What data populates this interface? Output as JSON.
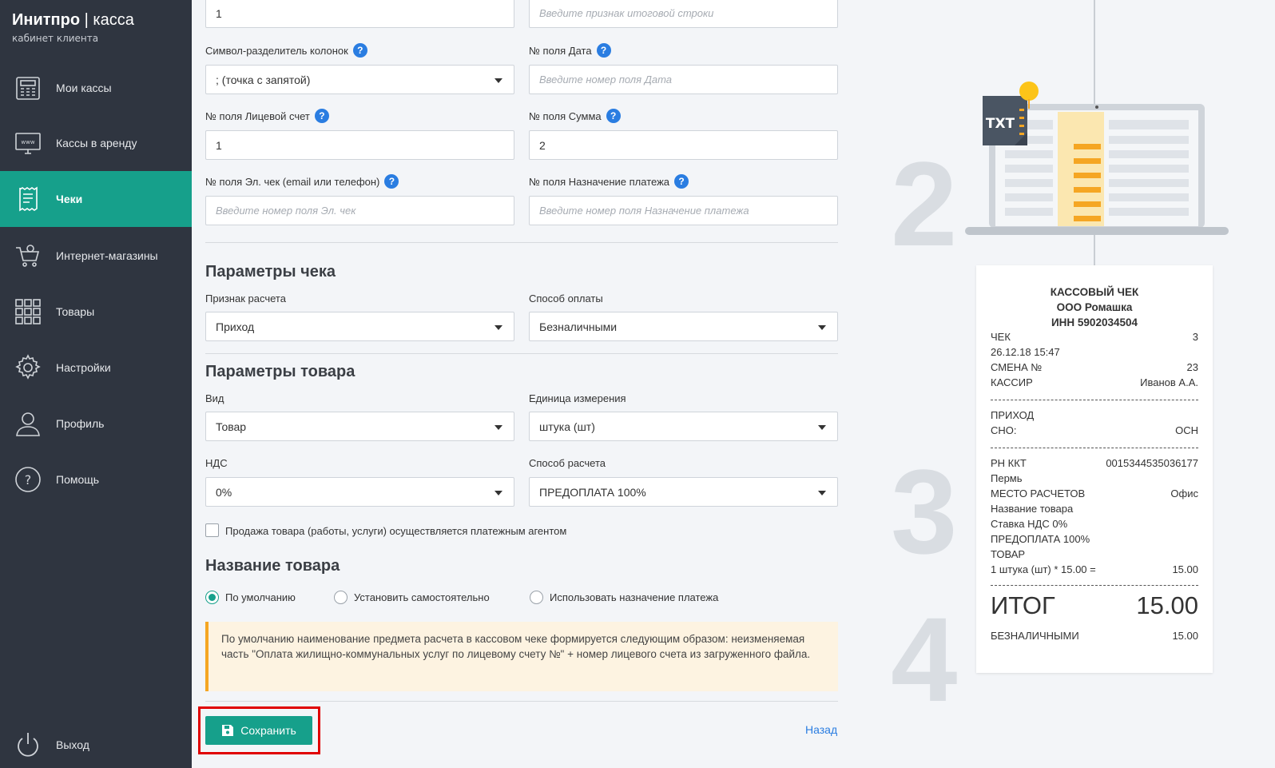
{
  "brand": {
    "name": "Инитпро",
    "sep": " | ",
    "product": "касса",
    "subtitle": "кабинет клиента"
  },
  "sidebar": {
    "items": [
      {
        "label": "Мои кассы"
      },
      {
        "label": "Кассы в аренду"
      },
      {
        "label": "Чеки"
      },
      {
        "label": "Интернет-магазины"
      },
      {
        "label": "Товары"
      },
      {
        "label": "Настройки"
      },
      {
        "label": "Профиль"
      },
      {
        "label": "Помощь"
      }
    ],
    "active_index": 2,
    "logout": "Выход"
  },
  "form": {
    "top_left_value": "1",
    "top_right_placeholder": "Введите признак итоговой строки",
    "col_sep": {
      "label": "Символ-разделитель колонок",
      "value": "; (точка с запятой)"
    },
    "date_field": {
      "label": "№ поля Дата",
      "placeholder": "Введите номер поля Дата"
    },
    "account_field": {
      "label": "№ поля Лицевой счет",
      "value": "1"
    },
    "sum_field": {
      "label": "№ поля Сумма",
      "value": "2"
    },
    "echeck_field": {
      "label": "№ поля Эл. чек (email или телефон)",
      "placeholder": "Введите номер поля Эл. чек"
    },
    "purpose_field": {
      "label": "№ поля Назначение платежа",
      "placeholder": "Введите номер поля Назначение платежа"
    },
    "check_params": {
      "title": "Параметры чека",
      "calc_sign": {
        "label": "Признак расчета",
        "value": "Приход"
      },
      "pay_method": {
        "label": "Способ оплаты",
        "value": "Безналичными"
      }
    },
    "product_params": {
      "title": "Параметры товара",
      "kind": {
        "label": "Вид",
        "value": "Товар"
      },
      "unit": {
        "label": "Единица измерения",
        "value": "штука (шт)"
      },
      "vat": {
        "label": "НДС",
        "value": "0%"
      },
      "calc_method": {
        "label": "Способ расчета",
        "value": "ПРЕДОПЛАТА 100%"
      },
      "agent_checkbox": "Продажа товара (работы, услуги) осуществляется платежным агентом"
    },
    "product_name": {
      "title": "Название товара",
      "options": [
        "По умолчанию",
        "Установить самостоятельно",
        "Использовать назначение платежа"
      ],
      "selected": 0,
      "note": "По умолчанию наименование предмета расчета в кассовом чеке формируется следующим образом: неизменяемая часть \"Оплата жилищно-коммунальных услуг по лицевому счету №\" + номер лицевого счета из загруженного файла."
    },
    "save_label": "Сохранить",
    "back_label": "Назад"
  },
  "illustration": {
    "step_numbers": [
      "2",
      "3",
      "4"
    ],
    "txt_label": "TXT",
    "receipt": {
      "title": "КАССОВЫЙ ЧЕК",
      "org": "ООО Ромашка",
      "inn": "ИНН 5902034504",
      "check_label": "ЧЕК",
      "check_no": "3",
      "datetime": "26.12.18 15:47",
      "shift_label": "СМЕНА №",
      "shift_no": "23",
      "cashier_label": "КАССИР",
      "cashier": "Иванов А.А.",
      "income": "ПРИХОД",
      "sno_label": "СНО:",
      "sno": "ОСН",
      "rn_label": "РН ККТ",
      "rn": "0015344535036177",
      "city": "Пермь",
      "place_label": "МЕСТО РАСЧЕТОВ",
      "place": "Офис",
      "product_name": "Название товара",
      "vat_rate": "Ставка НДС 0%",
      "prepay": "ПРЕДОПЛАТА 100%",
      "goods": "ТОВАР",
      "qty_line": "1 штука (шт) * 15.00 =",
      "qty_sum": "15.00",
      "total_label": "ИТОГ",
      "total": "15.00",
      "cashless_label": "БЕЗНАЛИЧНЫМИ",
      "cashless": "15.00"
    }
  },
  "colors": {
    "sidebar": "#2f3540",
    "accent": "#16a08b",
    "link": "#2a7de1",
    "note_border": "#f5a623",
    "highlight": "#e00000"
  }
}
